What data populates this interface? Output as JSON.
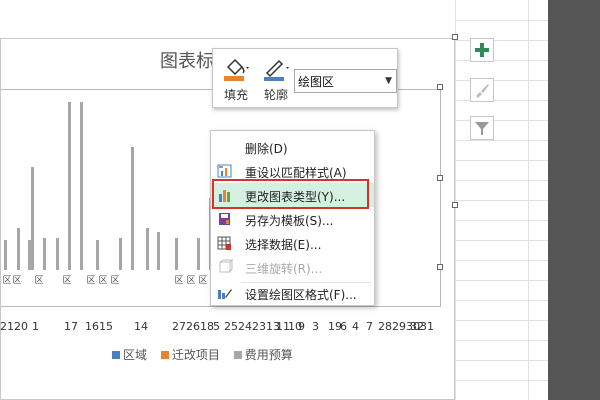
{
  "chart": {
    "title": "图表标",
    "legend": [
      {
        "label": "区域",
        "color": "#4a7fc1"
      },
      {
        "label": "迁改项目",
        "color": "#e8832f"
      },
      {
        "label": "费用预算",
        "color": "#a6a6a6"
      }
    ],
    "x_numbers": [
      "21",
      "20",
      "1",
      "17",
      "1615",
      "14",
      "272618",
      "5",
      "25242313",
      "11",
      "10",
      "9",
      "3",
      "19",
      "6",
      "4",
      "7",
      "28293031",
      "32"
    ],
    "vertical_labels": [
      "区",
      "区",
      "区",
      "区",
      "区",
      "区",
      "区",
      "区",
      "区",
      "区"
    ]
  },
  "mini_toolbar": {
    "fill_label": "填充",
    "outline_label": "轮廓",
    "element_selected": "绘图区"
  },
  "context_menu": {
    "items": [
      {
        "label": "删除(D)",
        "enabled": true
      },
      {
        "label": "重设以匹配样式(A)",
        "enabled": true
      },
      {
        "label": "更改图表类型(Y)...",
        "enabled": true,
        "active": true
      },
      {
        "label": "另存为模板(S)...",
        "enabled": true
      },
      {
        "label": "选择数据(E)...",
        "enabled": true
      },
      {
        "label": "三维旋转(R)...",
        "enabled": false
      },
      {
        "label": "设置绘图区格式(F)...",
        "enabled": true
      }
    ]
  },
  "colors": {
    "accent_green": "#2e8b57",
    "highlight_red": "#d9302b",
    "bar_gray": "#a6a6a6"
  }
}
